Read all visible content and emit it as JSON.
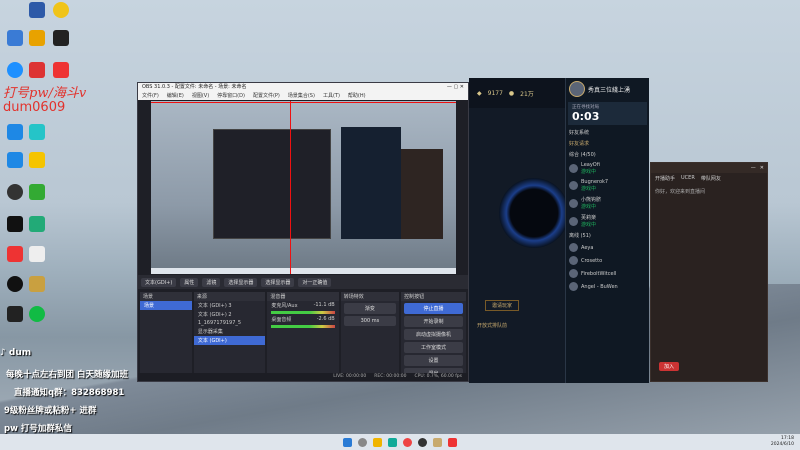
{
  "desktop_icons": [
    {
      "label": "",
      "color": "#2d5aa8"
    },
    {
      "label": "",
      "color": "#f0c419"
    },
    {
      "label": "",
      "color": "#3a7bd5"
    },
    {
      "label": "",
      "color": "#1e90ff"
    },
    {
      "label": "",
      "color": "#d33"
    },
    {
      "label": "",
      "color": "#1e88e5"
    }
  ],
  "watermark": {
    "line1": "打号pw/海斗v",
    "line2": "dum0609"
  },
  "overlay": {
    "douyin": "dum",
    "line1": "每晚十点左右到团  白天随缘加班",
    "line2": "直播通知q群：832868981",
    "line3": "9级粉丝牌或粘粉+  进群",
    "line4": "pw 打号加群私信"
  },
  "obs": {
    "title": "OBS 31.0.3 - 配置文件: 未命名 - 场景: 未命名",
    "menu": [
      "文件(F)",
      "编辑(E)",
      "视图(V)",
      "停靠窗口(D)",
      "配置文件(P)",
      "场景集合(S)",
      "工具(T)",
      "帮助(H)"
    ],
    "toolbar": [
      "文本(GDI+)",
      "属性",
      "滤镜",
      "选择显示器",
      "选择显示器",
      "对一正确值"
    ],
    "scenes_title": "场景",
    "scenes": [
      "场景"
    ],
    "sources_title": "来源",
    "sources": [
      "文本 (GDI+) 3",
      "文本 (GDI+) 2",
      "1_1697179197_5",
      "显示器采集",
      "文本 (GDI+)"
    ],
    "mixer_title": "混音器",
    "mixer": [
      {
        "name": "麦克风/Aux",
        "db": "-11.1 dB"
      },
      {
        "name": "桌面音频",
        "db": "-2.6 dB"
      }
    ],
    "transitions_title": "转场特效",
    "transition": "渐变",
    "duration": "300 ms",
    "controls_title": "控制按钮",
    "controls": [
      "停止直播",
      "开始录制",
      "启动虚拟摄像机",
      "工作室模式",
      "设置",
      "退出"
    ],
    "status": {
      "live": "LIVE: 00:00:00",
      "rec": "REC: 00:00:00",
      "cpu": "CPU: 0.7%, 60.00 fps"
    }
  },
  "lol": {
    "coins": "9177",
    "points": "21万",
    "user": "秀真三位綫上湧",
    "status": "正在寻找对局",
    "timer": "0:03",
    "friends_title": "好友系统",
    "friends_header": "好友请求",
    "group1": "综合 (4/50)",
    "friends": [
      {
        "name": "LeayOfi",
        "state": "游戏中"
      },
      {
        "name": "Bugnerok7",
        "state": "游戏中"
      },
      {
        "name": "小熊钩脐",
        "state": "游戏中"
      },
      {
        "name": "芙莉楽",
        "state": "游戏中"
      }
    ],
    "group2": "离线 (51)",
    "offline": [
      "Aeya",
      "Crosetto",
      "FireboltWitcell",
      "Angel - BuWen"
    ],
    "bottom_button": "邀请玩家",
    "mode_text": "开放式排队前"
  },
  "chat": {
    "tabs": [
      "开播助手",
      "UCER",
      "带队网友"
    ],
    "line1": "你好，欢迎来到直播间",
    "button": "加入"
  },
  "taskbar": {
    "time": "17:18",
    "date": "2024/6/10"
  },
  "colors": {
    "obs_blue": "#3f6ad4",
    "red_guide": "#e11111",
    "lol_gold": "#d8c68a"
  }
}
